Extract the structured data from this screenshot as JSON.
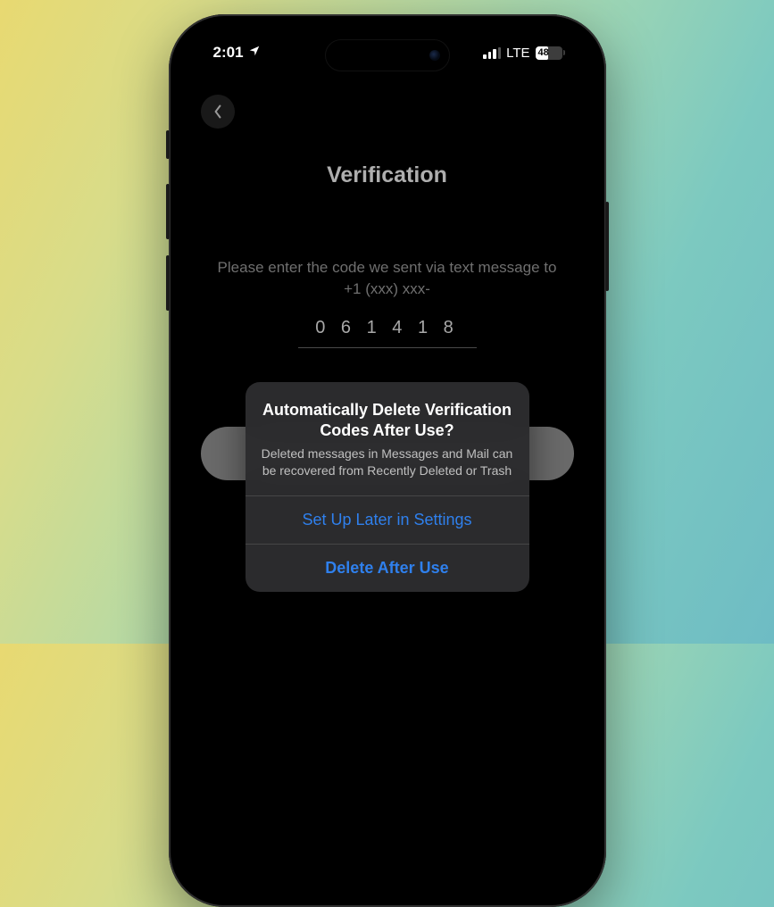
{
  "status": {
    "time": "2:01",
    "network": "LTE",
    "battery": "48"
  },
  "page": {
    "title": "Verification",
    "instructions": "Please enter the code we sent via text message to +1 (xxx) xxx-",
    "code": "0 6 1 4 1 8"
  },
  "alert": {
    "title": "Automatically Delete Verification Codes After Use?",
    "body": "Deleted messages in Messages and Mail can be recovered from Recently Deleted or Trash",
    "button_later": "Set Up Later in Settings",
    "button_delete": "Delete After Use"
  }
}
